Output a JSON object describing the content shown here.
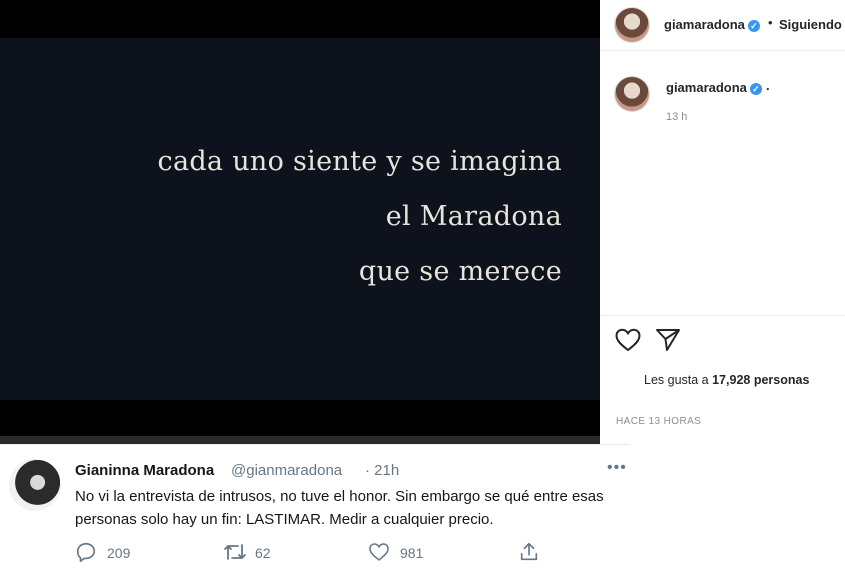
{
  "instagram": {
    "media_lines": [
      "cada uno siente y se imagina",
      "el Maradona",
      "que se merece"
    ],
    "username": "giamaradona",
    "verified_mark": "✓",
    "follow_status": "Siguiendo",
    "header_separator": "•",
    "caption": ".",
    "post_time": "13 h",
    "likes_prefix": "Les gusta a ",
    "likes_count": "17,928 personas",
    "time_ago": "HACE 13 HORAS",
    "icons": [
      "heart-icon",
      "share-icon"
    ]
  },
  "twitter": {
    "name": "Gianinna Maradona",
    "handle": "@gianmaradona",
    "time": "· 21h",
    "more": "•••",
    "text": "No vi la entrevista de intrusos, no tuve el honor. Sin embargo se qué entre esas personas solo hay un fin: LASTIMAR. Medir a cualquier precio.",
    "replies": "209",
    "retweets": "62",
    "likes": "981",
    "icons": [
      "reply-icon",
      "retweet-icon",
      "like-icon",
      "share-icon"
    ]
  }
}
